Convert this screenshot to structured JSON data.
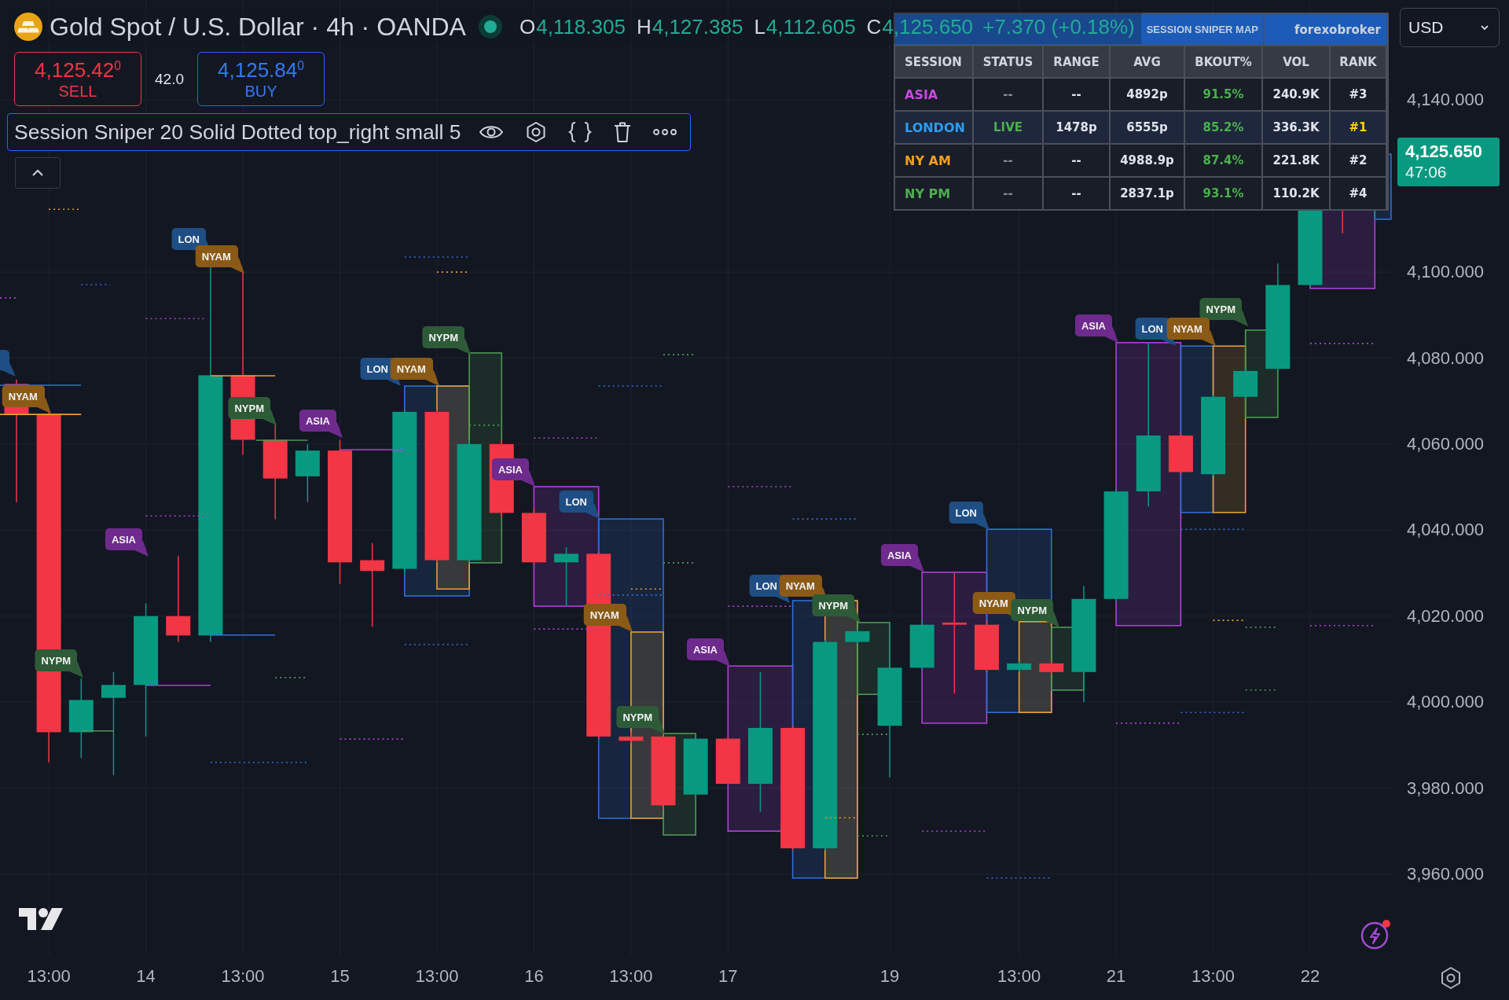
{
  "header": {
    "symbol_title": "Gold Spot / U.S. Dollar · 4h · OANDA",
    "market_open": true,
    "ohlc": [
      {
        "key": "O",
        "value": "4,118.305"
      },
      {
        "key": "H",
        "value": "4,127.385"
      },
      {
        "key": "L",
        "value": "4,112.605"
      },
      {
        "key": "C",
        "value": "4,125.650"
      }
    ],
    "change": "+7.370 (+0.18%)"
  },
  "trade": {
    "sell": {
      "price": "4,125.42$^{0}$",
      "label": "SELL"
    },
    "spread": "42.0",
    "buy": {
      "price": "4,125.84$^{0}$",
      "label": "BUY"
    }
  },
  "indicator": {
    "title": "Session Sniper 20 Solid Dotted top_right small 5"
  },
  "currency": "USD",
  "table": {
    "title": "SESSION SNIPER MAP",
    "author": "forexobroker",
    "columns": [
      "SESSION",
      "STATUS",
      "RANGE",
      "AVG",
      "BKOUT%",
      "VOL",
      "RANK"
    ],
    "rows": [
      {
        "color": "#c84be0",
        "live": false,
        "top_rank": false,
        "cells": [
          "ASIA",
          "--",
          "--",
          "4892p",
          "91.5%",
          "240.9K",
          "#3"
        ]
      },
      {
        "color": "#2d9cf0",
        "live": true,
        "top_rank": true,
        "cells": [
          "LONDON",
          "LIVE",
          "1478p",
          "6555p",
          "85.2%",
          "336.3K",
          "#1"
        ]
      },
      {
        "color": "#f0a020",
        "live": false,
        "top_rank": false,
        "cells": [
          "NY AM",
          "--",
          "--",
          "4988.9p",
          "87.4%",
          "221.8K",
          "#2"
        ]
      },
      {
        "color": "#4caf50",
        "live": false,
        "top_rank": false,
        "cells": [
          "NY PM",
          "--",
          "--",
          "2837.1p",
          "93.1%",
          "110.2K",
          "#4"
        ]
      }
    ]
  },
  "chart": {
    "session_tags": [
      {
        "label": "NYAM",
        "color": "#8b5a17"
      },
      {
        "label": "ASIA",
        "color": "#6e2a8c"
      },
      {
        "label": "NYPM",
        "color": "#2e5b37"
      },
      {
        "label": "LON",
        "color": "#1f4e85"
      },
      {
        "label": "NYAM",
        "color": "#8b5a17"
      },
      {
        "label": "NYPM",
        "color": "#2e5b37"
      },
      {
        "label": "ASIA",
        "color": "#6e2a8c"
      },
      {
        "label": "NYPM",
        "color": "#2e5b37"
      },
      {
        "label": "LON",
        "color": "#1f4e85"
      },
      {
        "label": "NYAM",
        "color": "#8b5a17"
      },
      {
        "label": "ASIA",
        "color": "#6e2a8c"
      },
      {
        "label": "LON",
        "color": "#1f4e85"
      },
      {
        "label": "NYAM",
        "color": "#8b5a17"
      },
      {
        "label": "NYPM",
        "color": "#2e5b37"
      },
      {
        "label": "ASIA",
        "color": "#6e2a8c"
      },
      {
        "label": "LON",
        "color": "#1f4e85"
      },
      {
        "label": "NYAM",
        "color": "#8b5a17"
      },
      {
        "label": "NYPM",
        "color": "#2e5b37"
      },
      {
        "label": "ASIA",
        "color": "#6e2a8c"
      },
      {
        "label": "LON",
        "color": "#1f4e85"
      },
      {
        "label": "NYAM",
        "color": "#8b5a17"
      },
      {
        "label": "NYPM",
        "color": "#2e5b37"
      },
      {
        "label": "ASIA",
        "color": "#6e2a8c"
      },
      {
        "label": "NYPM",
        "color": "#2e5b37"
      },
      {
        "label": "LON",
        "color": "#1f4e85"
      },
      {
        "label": "NYAM",
        "color": "#8b5a17"
      }
    ],
    "price_axis": [
      "4,140.000",
      "4,100.000",
      "4,080.000",
      "4,060.000",
      "4,040.000",
      "4,020.000",
      "4,000.000",
      "3,980.000",
      "3,960.000"
    ],
    "time_axis": [
      "13:00",
      "14",
      "13:00",
      "15",
      "13:00",
      "16",
      "13:00",
      "17",
      "19",
      "13:00",
      "21",
      "13:00",
      "22"
    ],
    "price_tag": {
      "price": "4,125.650",
      "countdown": "47:06"
    }
  }
}
